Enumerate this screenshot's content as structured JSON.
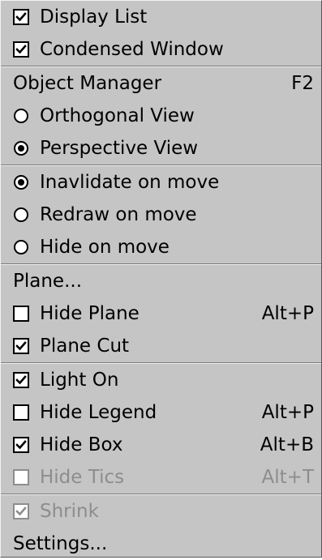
{
  "menu": {
    "groups": [
      [
        {
          "kind": "check",
          "checked": true,
          "label": "Display List",
          "shortcut": "",
          "enabled": true
        },
        {
          "kind": "check",
          "checked": true,
          "label": "Condensed Window",
          "shortcut": "",
          "enabled": true
        }
      ],
      [
        {
          "kind": "plain",
          "checked": false,
          "label": "Object Manager",
          "shortcut": "F2",
          "enabled": true
        },
        {
          "kind": "radio",
          "checked": false,
          "label": "Orthogonal View",
          "shortcut": "",
          "enabled": true
        },
        {
          "kind": "radio",
          "checked": true,
          "label": "Perspective View",
          "shortcut": "",
          "enabled": true
        }
      ],
      [
        {
          "kind": "radio",
          "checked": true,
          "label": "Inavlidate on move",
          "shortcut": "",
          "enabled": true
        },
        {
          "kind": "radio",
          "checked": false,
          "label": "Redraw on move",
          "shortcut": "",
          "enabled": true
        },
        {
          "kind": "radio",
          "checked": false,
          "label": "Hide on move",
          "shortcut": "",
          "enabled": true
        }
      ],
      [
        {
          "kind": "plain",
          "checked": false,
          "label": "Plane...",
          "shortcut": "",
          "enabled": true
        },
        {
          "kind": "check",
          "checked": false,
          "label": "Hide Plane",
          "shortcut": "Alt+P",
          "enabled": true
        },
        {
          "kind": "check",
          "checked": true,
          "label": "Plane Cut",
          "shortcut": "",
          "enabled": true
        }
      ],
      [
        {
          "kind": "check",
          "checked": true,
          "label": "Light On",
          "shortcut": "",
          "enabled": true
        },
        {
          "kind": "check",
          "checked": false,
          "label": "Hide Legend",
          "shortcut": "Alt+P",
          "enabled": true
        },
        {
          "kind": "check",
          "checked": true,
          "label": "Hide Box",
          "shortcut": "Alt+B",
          "enabled": true
        },
        {
          "kind": "check",
          "checked": false,
          "label": "Hide Tics",
          "shortcut": "Alt+T",
          "enabled": false
        }
      ],
      [
        {
          "kind": "check",
          "checked": true,
          "label": "Shrink",
          "shortcut": "",
          "enabled": false
        },
        {
          "kind": "plain",
          "checked": false,
          "label": "Settings...",
          "shortcut": "",
          "enabled": true
        }
      ]
    ]
  }
}
